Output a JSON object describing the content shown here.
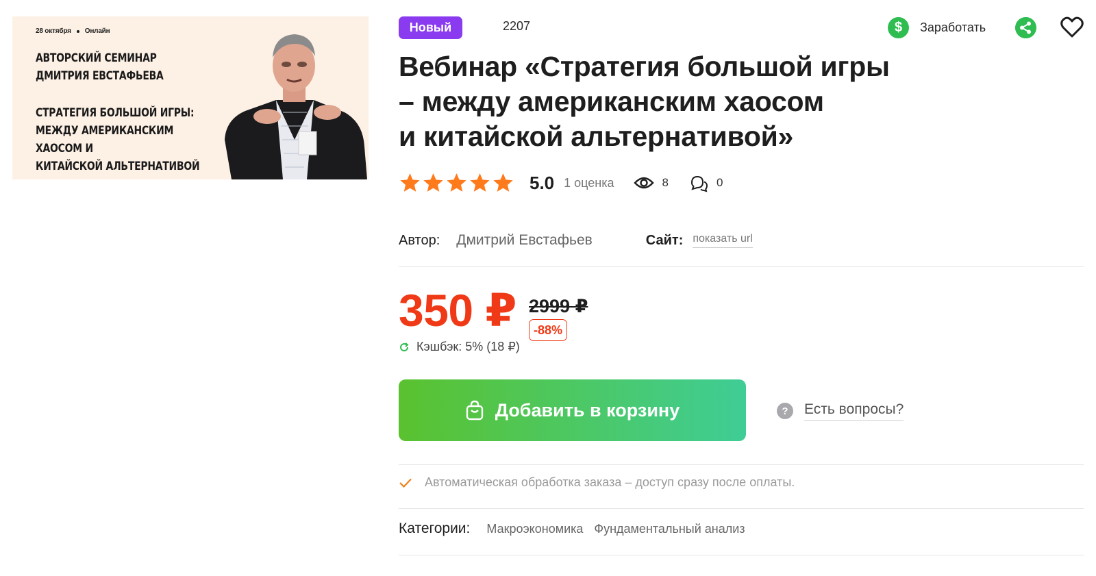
{
  "banner": {
    "date": "28 октября",
    "format": "Онлайн",
    "heading_line1": "АВТОРСКИЙ СЕМИНАР",
    "heading_line2": "ДМИТРИЯ ЕВСТАФЬЕВА",
    "subheading_line1": "СТРАТЕГИЯ БОЛЬШОЙ ИГРЫ:",
    "subheading_line2": "МЕЖДУ АМЕРИКАНСКИМ ХАОСОМ И",
    "subheading_line3": "КИТАЙСКОЙ АЛЬТЕРНАТИВОЙ"
  },
  "product": {
    "badge": "Новый",
    "id": "2207",
    "title_line1": "Вебинар «Стратегия большой игры",
    "title_line2": "– между американским хаосом",
    "title_line3": "и китайской альтернативой»",
    "rating_value": "5.0",
    "rating_stars": 5,
    "rating_count": "1 оценка",
    "views": "8",
    "comments": "0"
  },
  "actions": {
    "earn_label": "Заработать",
    "earn_icon": "dollar-icon",
    "share_icon": "share-icon",
    "favorite_icon": "heart-icon"
  },
  "meta": {
    "author_label": "Автор:",
    "author_name": "Дмитрий Евстафьев",
    "site_label": "Сайт:",
    "site_link": "показать url"
  },
  "pricing": {
    "price": "350 ₽",
    "old_price": "2999 ₽",
    "discount": "-88%",
    "cashback": "Кэшбэк: 5% (18 ₽)"
  },
  "cart": {
    "button_label": "Добавить в корзину",
    "questions_label": "Есть вопросы?"
  },
  "info": {
    "auto_processing": "Автоматическая обработка заказа – доступ сразу после оплаты."
  },
  "categories": {
    "label": "Категории:",
    "items": [
      "Макроэкономика",
      "Фундаментальный анализ"
    ]
  },
  "colors": {
    "accent_purple": "#8a3bf0",
    "price_red": "#f03a17",
    "green": "#2fbd52",
    "button_gradient_start": "#5ac22f",
    "button_gradient_end": "#3fcd96",
    "star_orange": "#ff7a1a"
  }
}
